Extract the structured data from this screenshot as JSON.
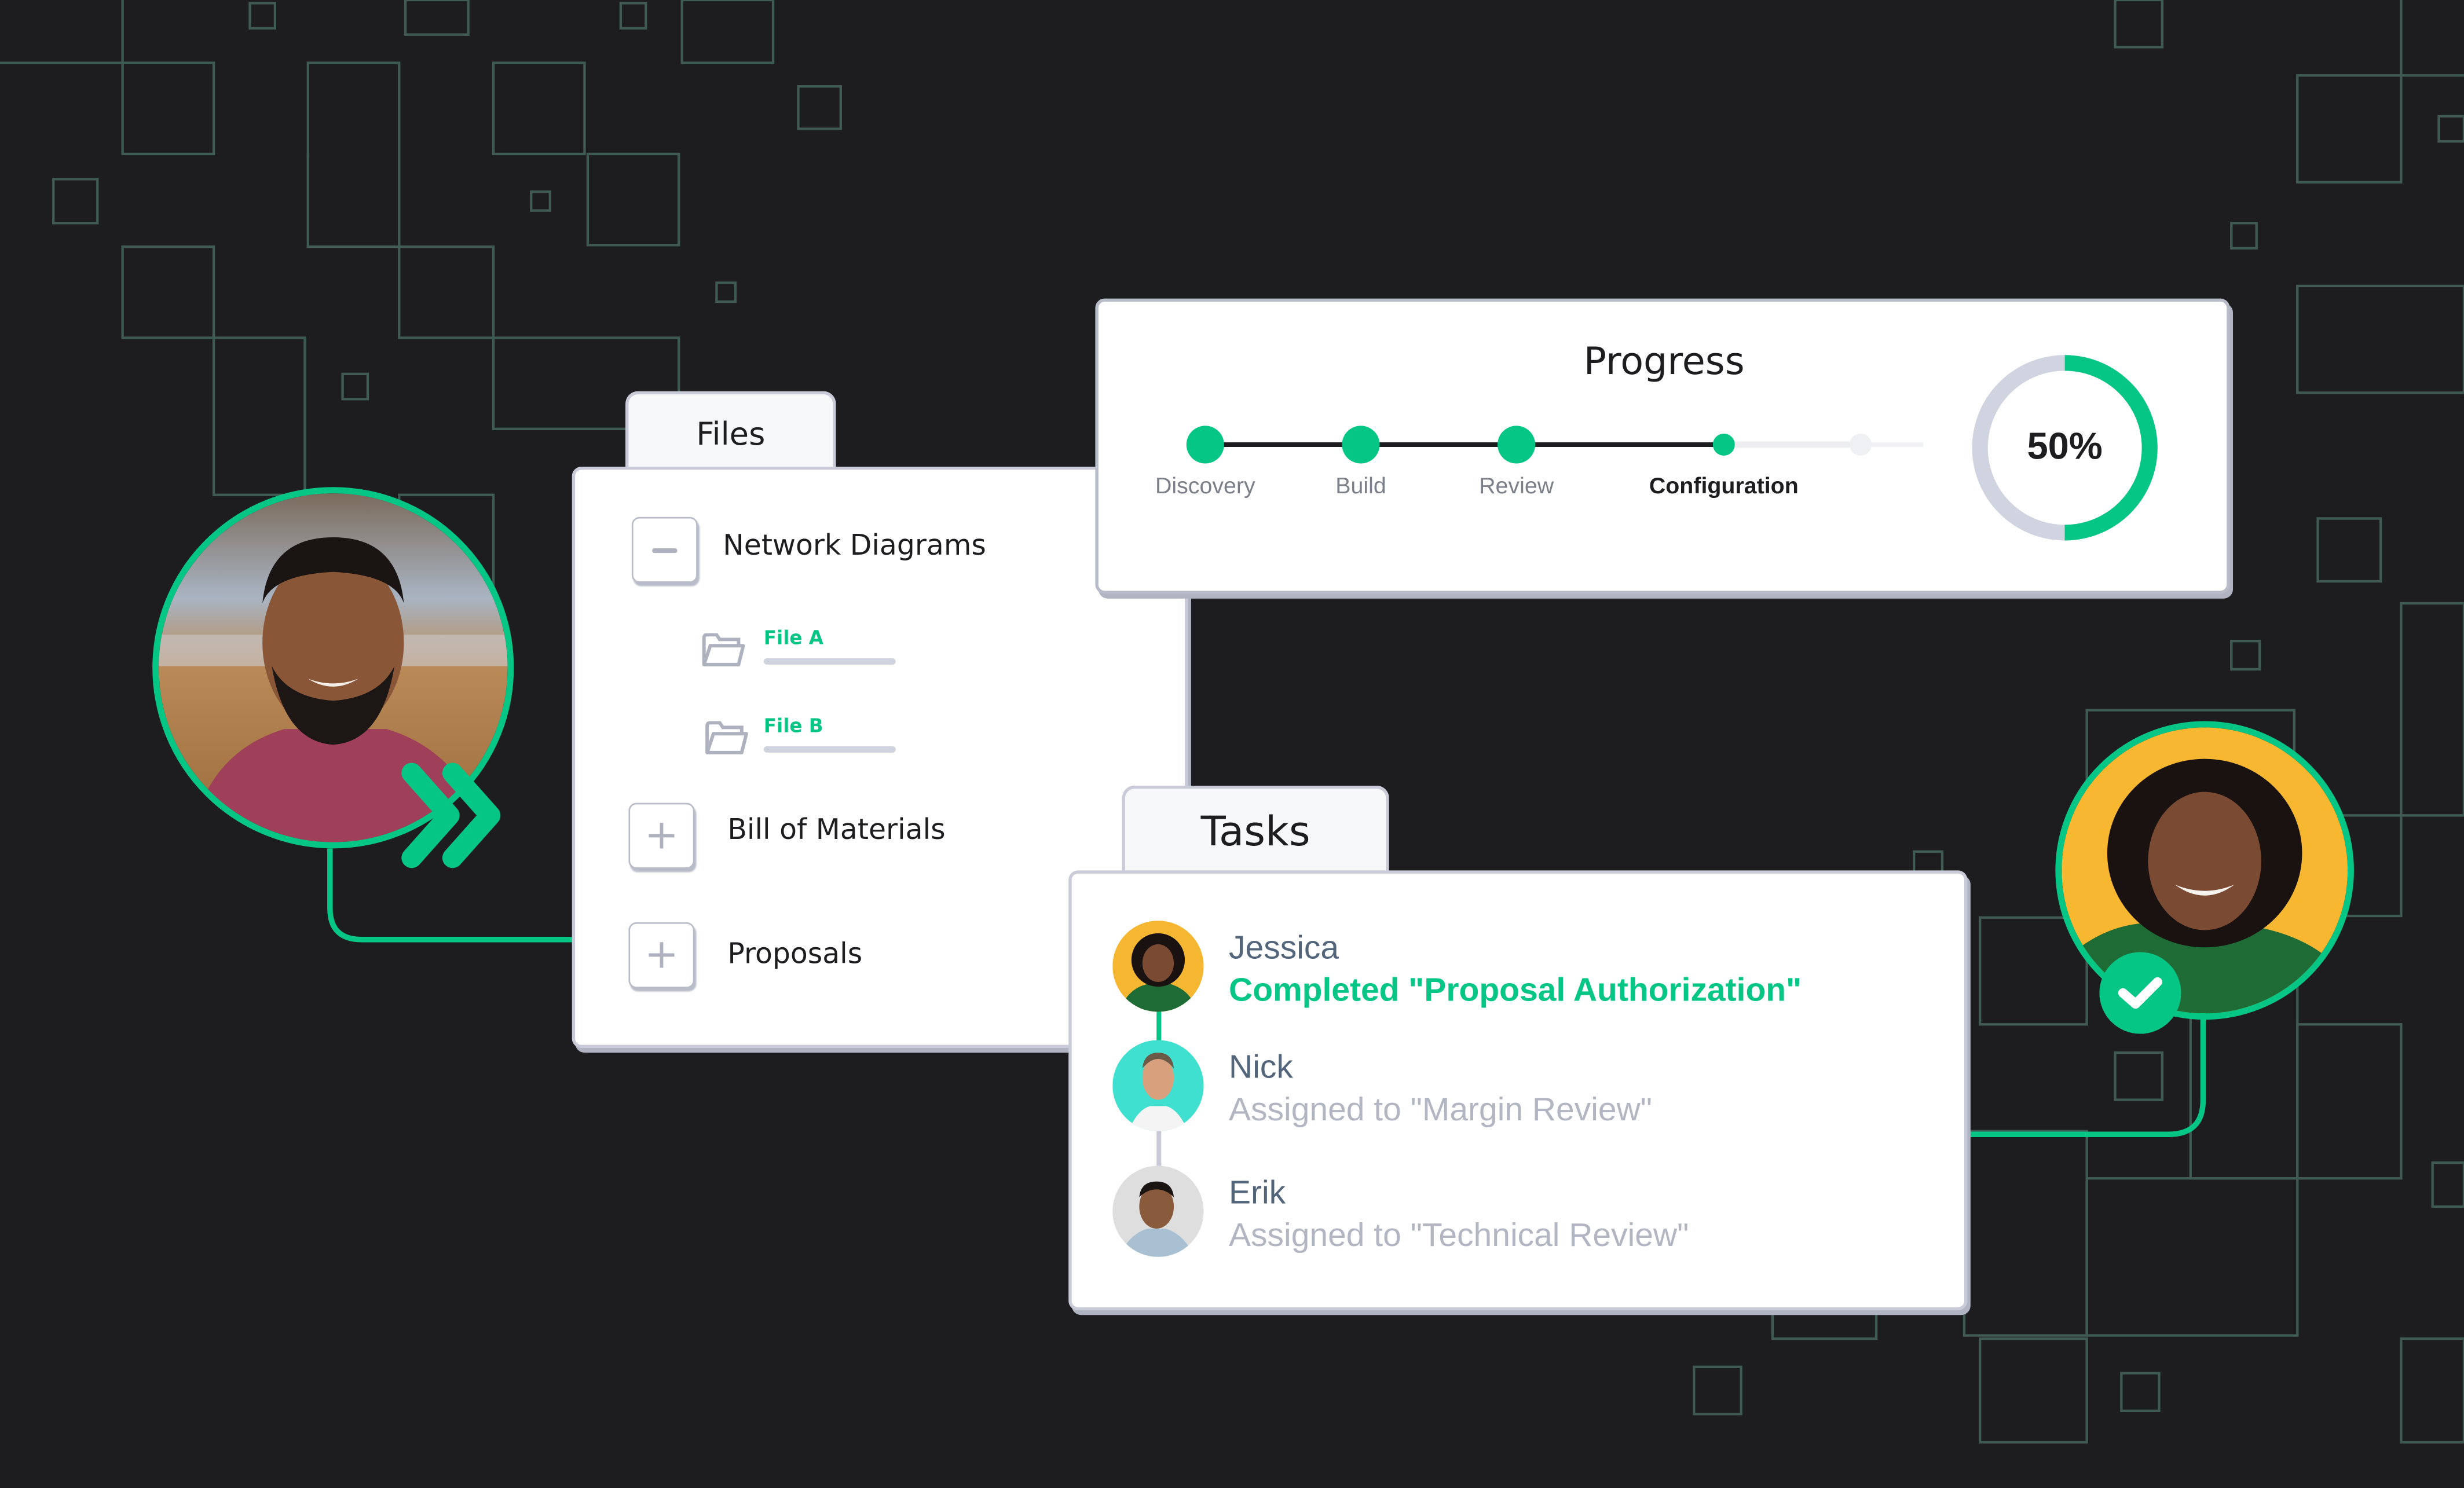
{
  "colors": {
    "accent": "#06c685",
    "background": "#1d1d1f",
    "grid_line": "#3f5a52",
    "muted_text": "#b2b6c2",
    "name_text": "#52657a",
    "ring_track": "#d0d3e0"
  },
  "files": {
    "tab_label": "Files",
    "items": [
      {
        "label": "Network Diagrams",
        "expanded": true,
        "toggle_icon": "minus-icon",
        "children": [
          {
            "label": "File A",
            "icon": "folder-open-icon"
          },
          {
            "label": "File B",
            "icon": "folder-open-icon"
          }
        ]
      },
      {
        "label": "Bill of Materials",
        "expanded": false,
        "toggle_icon": "plus-icon"
      },
      {
        "label": "Proposals",
        "expanded": false,
        "toggle_icon": "plus-icon"
      }
    ]
  },
  "progress": {
    "title": "Progress",
    "steps": [
      {
        "label": "Discovery",
        "status": "complete"
      },
      {
        "label": "Build",
        "status": "complete"
      },
      {
        "label": "Review",
        "status": "complete"
      },
      {
        "label": "Configuration",
        "status": "current"
      },
      {
        "label": "",
        "status": "upcoming"
      }
    ],
    "percent": 50,
    "percent_label": "50%"
  },
  "tasks": {
    "tab_label": "Tasks",
    "items": [
      {
        "name": "Jessica",
        "description": "Completed \"Proposal Authorization\"",
        "status": "completed",
        "avatar_bg": "#f5b731"
      },
      {
        "name": "Nick",
        "description": "Assigned to \"Margin Review\"",
        "status": "assigned",
        "avatar_bg": "#3fe0cf"
      },
      {
        "name": "Erik",
        "description": "Assigned to \"Technical Review\"",
        "status": "assigned",
        "avatar_bg": "#dedede"
      }
    ]
  },
  "people": {
    "left": {
      "role": "sender",
      "badge_icon": "double-chevron-right-icon",
      "photo_bg": "#8a4a3a"
    },
    "right": {
      "role": "approver",
      "badge_icon": "check-icon",
      "photo_bg": "#f7b731"
    }
  }
}
